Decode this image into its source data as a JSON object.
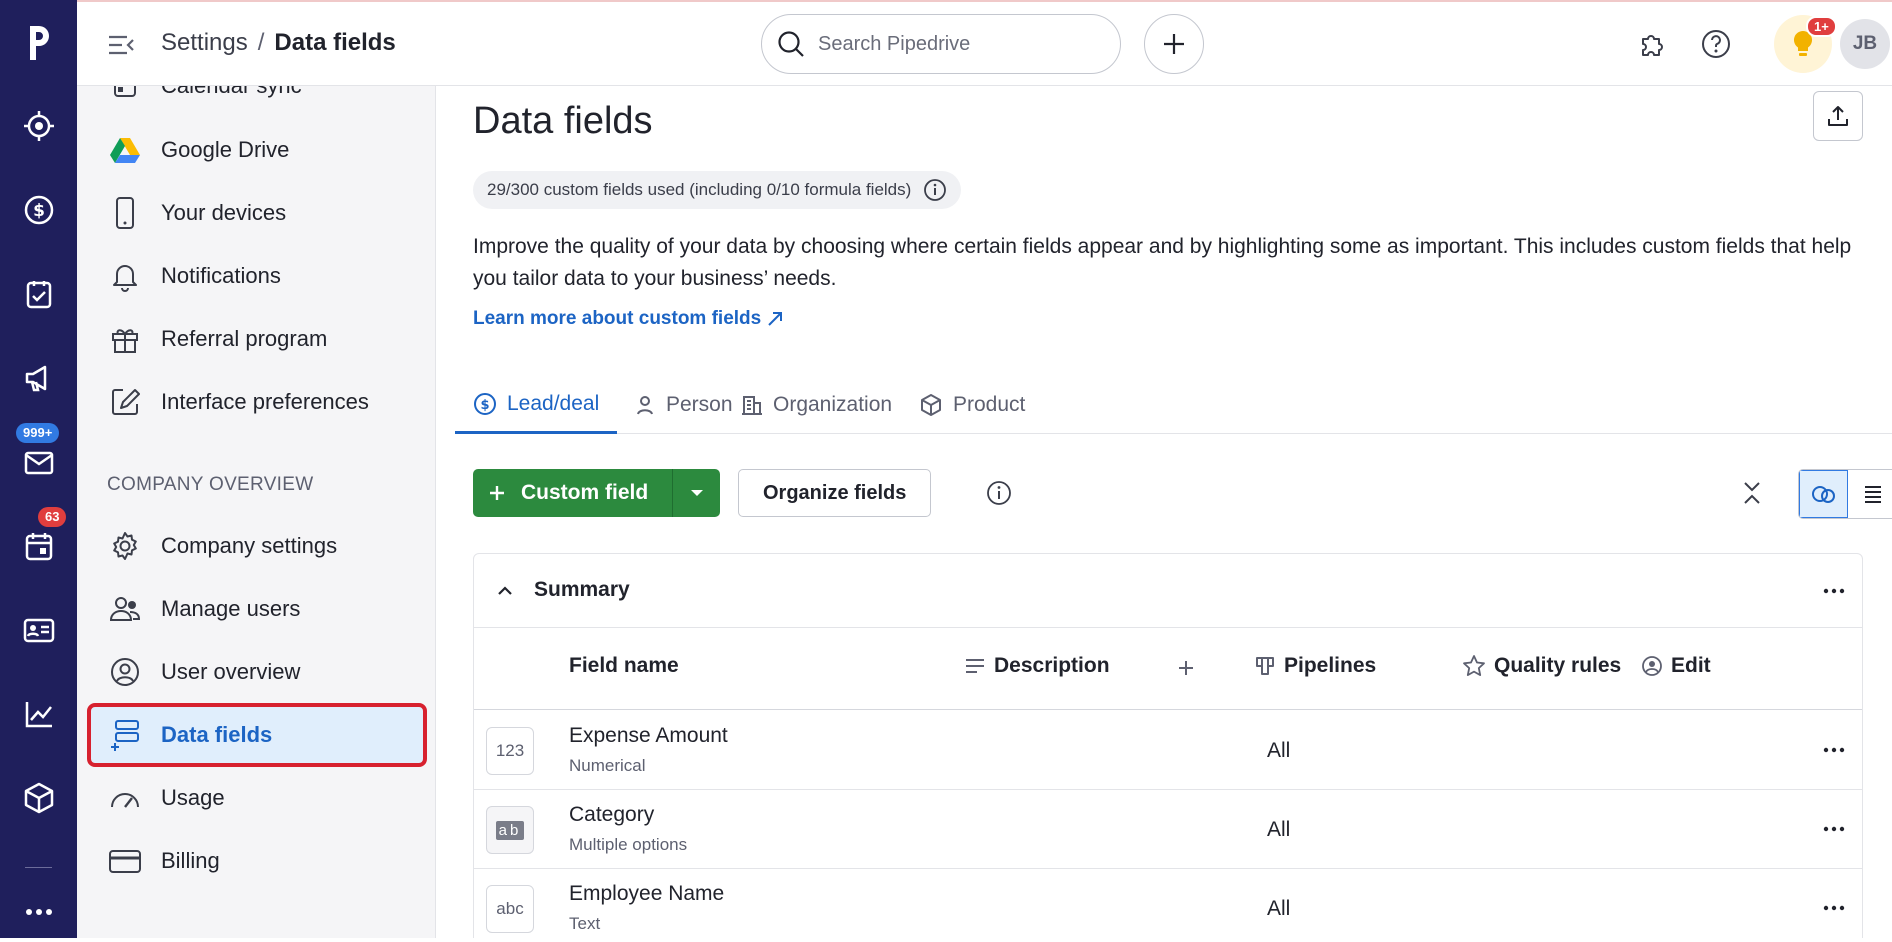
{
  "rail": {
    "badges": {
      "mail": "999+",
      "calendar": "63"
    }
  },
  "topbar": {
    "breadcrumb_parent": "Settings",
    "breadcrumb_sep": "/",
    "breadcrumb_current": "Data fields",
    "search_placeholder": "Search Pipedrive",
    "notif_badge": "1+",
    "avatar_initials": "JB"
  },
  "sidebar": {
    "items_top": [
      {
        "label": "Calendar sync",
        "icon": "calendar-sync-icon"
      },
      {
        "label": "Google Drive",
        "icon": "google-drive-icon"
      },
      {
        "label": "Your devices",
        "icon": "phone-icon"
      },
      {
        "label": "Notifications",
        "icon": "bell-icon"
      },
      {
        "label": "Referral program",
        "icon": "gift-icon"
      },
      {
        "label": "Interface preferences",
        "icon": "paint-icon"
      }
    ],
    "section_label": "COMPANY OVERVIEW",
    "items_company": [
      {
        "label": "Company settings",
        "icon": "gear-icon"
      },
      {
        "label": "Manage users",
        "icon": "users-icon"
      },
      {
        "label": "User overview",
        "icon": "user-circle-icon"
      },
      {
        "label": "Data fields",
        "icon": "data-fields-icon",
        "active": true
      },
      {
        "label": "Usage",
        "icon": "gauge-icon"
      },
      {
        "label": "Billing",
        "icon": "credit-card-icon"
      }
    ]
  },
  "main": {
    "title": "Data fields",
    "usage": "29/300 custom fields used (including 0/10 formula fields)",
    "description": "Improve the quality of your data by choosing where certain fields appear and by highlighting some as important. This includes custom fields that help you tailor data to your business’ needs.",
    "learn_more": "Learn more about custom fields",
    "tabs": [
      {
        "label": "Lead/deal",
        "active": true
      },
      {
        "label": "Person"
      },
      {
        "label": "Organization"
      },
      {
        "label": "Product"
      }
    ],
    "custom_field_label": "Custom field",
    "organize_label": "Organize fields",
    "section_title": "Summary",
    "columns": {
      "field_name": "Field name",
      "description": "Description",
      "pipelines": "Pipelines",
      "quality_rules": "Quality rules",
      "edit": "Edit"
    },
    "rows": [
      {
        "icon_text": "123",
        "name": "Expense Amount",
        "type": "Numerical",
        "pipelines": "All"
      },
      {
        "icon_text": "ab",
        "name": "Category",
        "type": "Multiple options",
        "pipelines": "All"
      },
      {
        "icon_text": "abc",
        "name": "Employee Name",
        "type": "Text",
        "pipelines": "All"
      }
    ]
  },
  "colors": {
    "rail_bg": "#1f1f5c",
    "accent_blue": "#1c64c4",
    "primary_green": "#2c8a3e",
    "highlight_red": "#d7212f"
  }
}
